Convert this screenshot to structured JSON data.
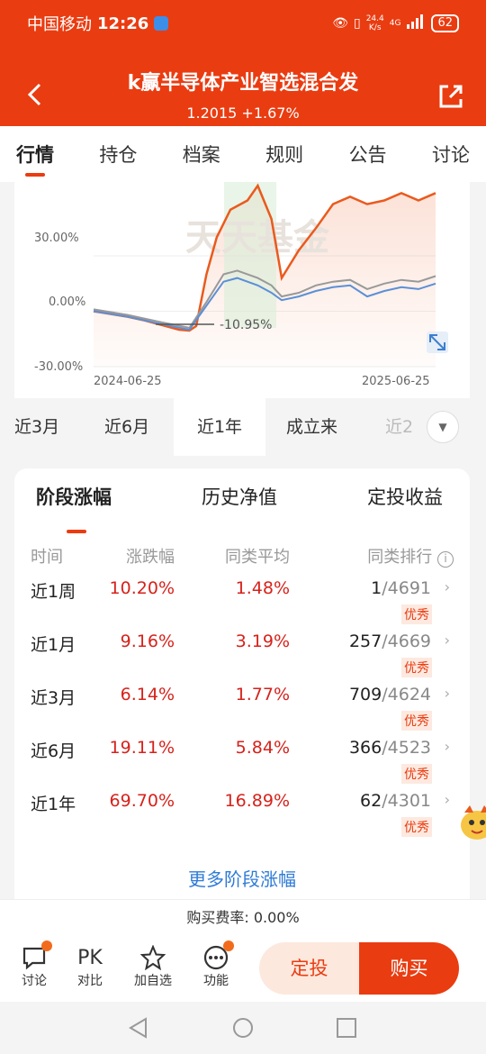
{
  "status_bar": {
    "carrier": "中国移动",
    "time": "12:26",
    "net_speed_value": "24.4",
    "net_speed_unit": "K/s",
    "net_type": "4G",
    "battery": "62"
  },
  "header": {
    "title": "k赢半导体产业智选混合发",
    "nav_line": "1.2015 +1.67%"
  },
  "tabs": [
    {
      "label": "行情",
      "active": true
    },
    {
      "label": "持仓",
      "active": false
    },
    {
      "label": "档案",
      "active": false
    },
    {
      "label": "规则",
      "active": false
    },
    {
      "label": "公告",
      "active": false
    },
    {
      "label": "讨论",
      "active": false
    }
  ],
  "chart_data": {
    "type": "line",
    "watermark": "天天基金",
    "y_ticks": [
      "30.00%",
      "0.00%",
      "-30.00%"
    ],
    "x_ticks": [
      "2024-06-25",
      "2025-06-25"
    ],
    "ylim": [
      -30,
      70
    ],
    "annotation": "-10.95%",
    "series": [
      {
        "color": "#ea5a1d",
        "points": [
          [
            0,
            0
          ],
          [
            0.1,
            -3
          ],
          [
            0.15,
            -5
          ],
          [
            0.25,
            -10
          ],
          [
            0.28,
            -10.5
          ],
          [
            0.3,
            -8
          ],
          [
            0.33,
            20
          ],
          [
            0.36,
            40
          ],
          [
            0.4,
            55
          ],
          [
            0.45,
            60
          ],
          [
            0.48,
            68
          ],
          [
            0.52,
            50
          ],
          [
            0.55,
            18
          ],
          [
            0.6,
            33
          ],
          [
            0.65,
            45
          ],
          [
            0.7,
            58
          ],
          [
            0.75,
            62
          ],
          [
            0.8,
            58
          ],
          [
            0.85,
            60
          ],
          [
            0.9,
            64
          ],
          [
            0.95,
            60
          ],
          [
            1.0,
            64
          ]
        ]
      },
      {
        "color": "#999999",
        "points": [
          [
            0,
            1
          ],
          [
            0.1,
            -2
          ],
          [
            0.2,
            -6
          ],
          [
            0.28,
            -9
          ],
          [
            0.33,
            5
          ],
          [
            0.38,
            20
          ],
          [
            0.42,
            22
          ],
          [
            0.48,
            18
          ],
          [
            0.52,
            14
          ],
          [
            0.55,
            8
          ],
          [
            0.6,
            10
          ],
          [
            0.65,
            14
          ],
          [
            0.7,
            16
          ],
          [
            0.75,
            17
          ],
          [
            0.8,
            12
          ],
          [
            0.85,
            15
          ],
          [
            0.9,
            17
          ],
          [
            0.95,
            16
          ],
          [
            1.0,
            19
          ]
        ]
      },
      {
        "color": "#5b8fd6",
        "points": [
          [
            0,
            0
          ],
          [
            0.1,
            -3
          ],
          [
            0.2,
            -7
          ],
          [
            0.28,
            -10
          ],
          [
            0.33,
            3
          ],
          [
            0.38,
            16
          ],
          [
            0.42,
            18
          ],
          [
            0.48,
            14
          ],
          [
            0.52,
            10
          ],
          [
            0.55,
            6
          ],
          [
            0.6,
            8
          ],
          [
            0.65,
            11
          ],
          [
            0.7,
            13
          ],
          [
            0.75,
            14
          ],
          [
            0.8,
            8
          ],
          [
            0.85,
            11
          ],
          [
            0.9,
            13
          ],
          [
            0.95,
            12
          ],
          [
            1.0,
            15
          ]
        ]
      }
    ]
  },
  "periods": [
    {
      "label": "近3月",
      "active": false
    },
    {
      "label": "近6月",
      "active": false
    },
    {
      "label": "近1年",
      "active": true
    },
    {
      "label": "成立来",
      "active": false
    },
    {
      "label": "近2",
      "active": false
    }
  ],
  "perf": {
    "sub_tabs": [
      "阶段涨幅",
      "历史净值",
      "定投收益"
    ],
    "columns": [
      "时间",
      "涨跌幅",
      "同类平均",
      "同类排行"
    ],
    "rows": [
      {
        "period": "近1周",
        "change": "10.20%",
        "avg": "1.48%",
        "rank": "1",
        "total": "/4691",
        "badge": "优秀"
      },
      {
        "period": "近1月",
        "change": "9.16%",
        "avg": "3.19%",
        "rank": "257",
        "total": "/4669",
        "badge": "优秀"
      },
      {
        "period": "近3月",
        "change": "6.14%",
        "avg": "1.77%",
        "rank": "709",
        "total": "/4624",
        "badge": "优秀"
      },
      {
        "period": "近6月",
        "change": "19.11%",
        "avg": "5.84%",
        "rank": "366",
        "total": "/4523",
        "badge": "优秀"
      },
      {
        "period": "近1年",
        "change": "69.70%",
        "avg": "16.89%",
        "rank": "62",
        "total": "/4301",
        "badge": "优秀"
      }
    ],
    "more_link": "更多阶段涨幅"
  },
  "fee": "购买费率: 0.00%",
  "bottom_bar": {
    "discuss": "讨论",
    "pk_icon_text": "PK",
    "compare": "对比",
    "watchlist": "加自选",
    "functions": "功能",
    "plan_button": "定投",
    "buy_button": "购买"
  }
}
